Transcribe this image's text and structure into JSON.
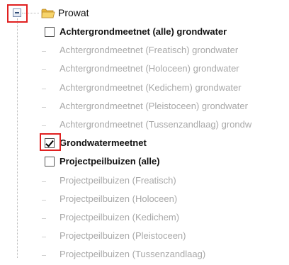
{
  "tree": {
    "root": {
      "label": "Prowat",
      "expanded": true,
      "icon": "folder-icon",
      "expander_icon": "collapse-icon"
    },
    "items": [
      {
        "label": "Achtergrondmeetnet (alle) grondwater",
        "enabled": true,
        "has_checkbox": true,
        "checked": false
      },
      {
        "label": "Achtergrondmeetnet (Freatisch) grondwater",
        "enabled": false,
        "has_checkbox": false
      },
      {
        "label": "Achtergrondmeetnet (Holoceen) grondwater",
        "enabled": false,
        "has_checkbox": false
      },
      {
        "label": "Achtergrondmeetnet (Kedichem) grondwater",
        "enabled": false,
        "has_checkbox": false
      },
      {
        "label": "Achtergrondmeetnet (Pleistoceen) grondwater",
        "enabled": false,
        "has_checkbox": false
      },
      {
        "label": "Achtergrondmeetnet (Tussenzandlaag) grondw",
        "enabled": false,
        "has_checkbox": false
      },
      {
        "label": "Grondwatermeetnet",
        "enabled": true,
        "has_checkbox": true,
        "checked": true
      },
      {
        "label": "Projectpeilbuizen (alle)",
        "enabled": true,
        "has_checkbox": true,
        "checked": false
      },
      {
        "label": "Projectpeilbuizen (Freatisch)",
        "enabled": false,
        "has_checkbox": false
      },
      {
        "label": "Projectpeilbuizen (Holoceen)",
        "enabled": false,
        "has_checkbox": false
      },
      {
        "label": "Projectpeilbuizen (Kedichem)",
        "enabled": false,
        "has_checkbox": false
      },
      {
        "label": "Projectpeilbuizen (Pleistoceen)",
        "enabled": false,
        "has_checkbox": false
      },
      {
        "label": "Projectpeilbuizen (Tussenzandlaag)",
        "enabled": false,
        "has_checkbox": false
      }
    ]
  },
  "colors": {
    "highlight": "#e02020",
    "disabled_text": "#a8a8a8",
    "folder": "#f2c94c"
  }
}
